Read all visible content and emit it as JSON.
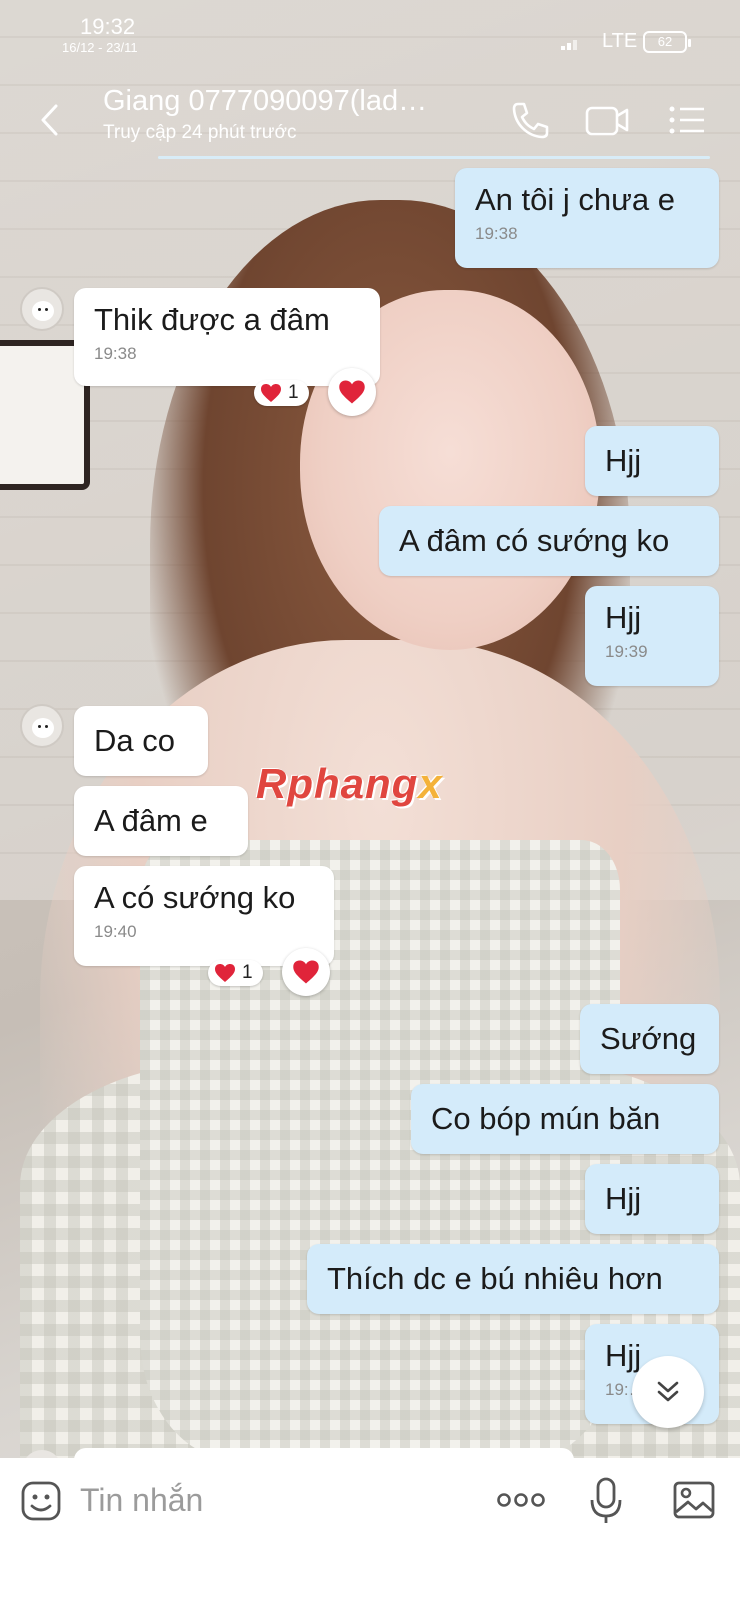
{
  "status_bar": {
    "time": "19:32",
    "date": "16/12 - 23/11",
    "network": "LTE",
    "battery": "62"
  },
  "header": {
    "title": "Giang 0777090097(lad…",
    "subtitle": "Truy cập 24 phút trước"
  },
  "messages": [
    {
      "dir": "out",
      "text": "An tôi j chưa e",
      "time": "19:38"
    },
    {
      "dir": "in",
      "text": "Thik được a đâm",
      "time": "19:38",
      "reaction_count": "1"
    },
    {
      "dir": "out",
      "text": "Hjj"
    },
    {
      "dir": "out",
      "text": "A đâm có sướng ko"
    },
    {
      "dir": "out",
      "text": "Hjj",
      "time": "19:39"
    },
    {
      "dir": "in",
      "text": "Da co"
    },
    {
      "dir": "in",
      "text": "A đâm e"
    },
    {
      "dir": "in",
      "text": "A có sướng ko",
      "time": "19:40",
      "reaction_count": "1"
    },
    {
      "dir": "out",
      "text": "Sướng"
    },
    {
      "dir": "out",
      "text": "Co bóp mún băn"
    },
    {
      "dir": "out",
      "text": "Hjj"
    },
    {
      "dir": "out",
      "text": "Thích dc e bú nhiêu hơn"
    },
    {
      "dir": "out",
      "text": "Hjj",
      "time": "19:…"
    }
  ],
  "watermark": {
    "main": "Rphang",
    "accent": "x"
  },
  "input": {
    "placeholder": "Tin nhắn"
  },
  "icons": [
    "back-arrow-icon",
    "phone-icon",
    "video-call-icon",
    "menu-icon",
    "heart-icon",
    "chevron-down-icon",
    "sticker-icon",
    "more-dots-icon",
    "microphone-icon",
    "image-icon"
  ],
  "colors": {
    "outgoing_bubble": "#d4ebfa",
    "incoming_bubble": "#ffffff",
    "heart": "#e0243a"
  }
}
